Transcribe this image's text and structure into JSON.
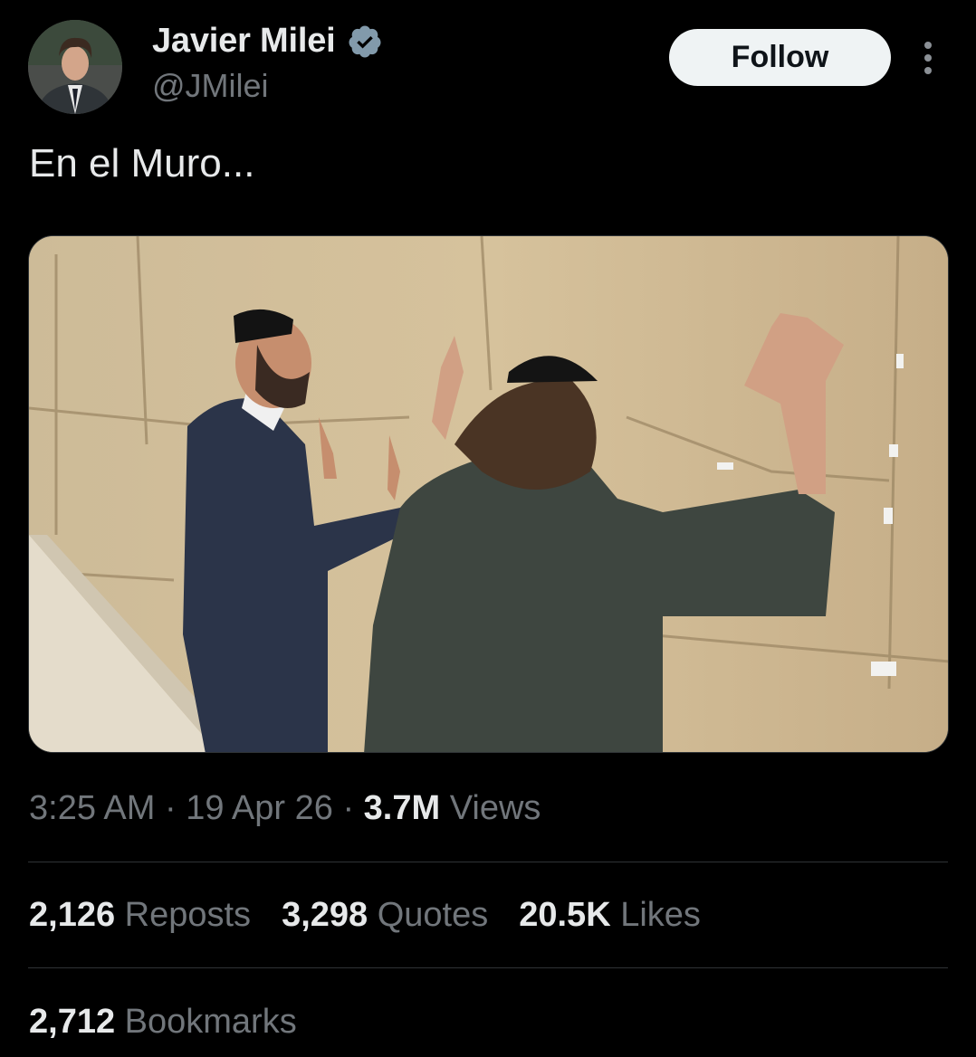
{
  "author": {
    "display_name": "Javier Milei",
    "handle": "@JMilei",
    "verified": true,
    "avatar_icon": "profile-photo"
  },
  "actions": {
    "follow_label": "Follow",
    "more_icon": "more-vertical-icon"
  },
  "tweet": {
    "text": "En el Muro..."
  },
  "meta": {
    "time": "3:25 AM",
    "separator": " · ",
    "date": "19 Apr 26",
    "views_count": "3.7M",
    "views_label": " Views"
  },
  "stats": [
    {
      "count": "2,126",
      "label": " Reposts"
    },
    {
      "count": "3,298",
      "label": " Quotes"
    },
    {
      "count": "20.5K",
      "label": " Likes"
    }
  ],
  "bookmarks": {
    "count": "2,712",
    "label": " Bookmarks"
  },
  "colors": {
    "background": "#000000",
    "text_primary": "#e7e9ea",
    "text_secondary": "#71767b",
    "divider": "#2f3336",
    "follow_bg": "#eff3f4",
    "verified_badge": "#829aab"
  }
}
